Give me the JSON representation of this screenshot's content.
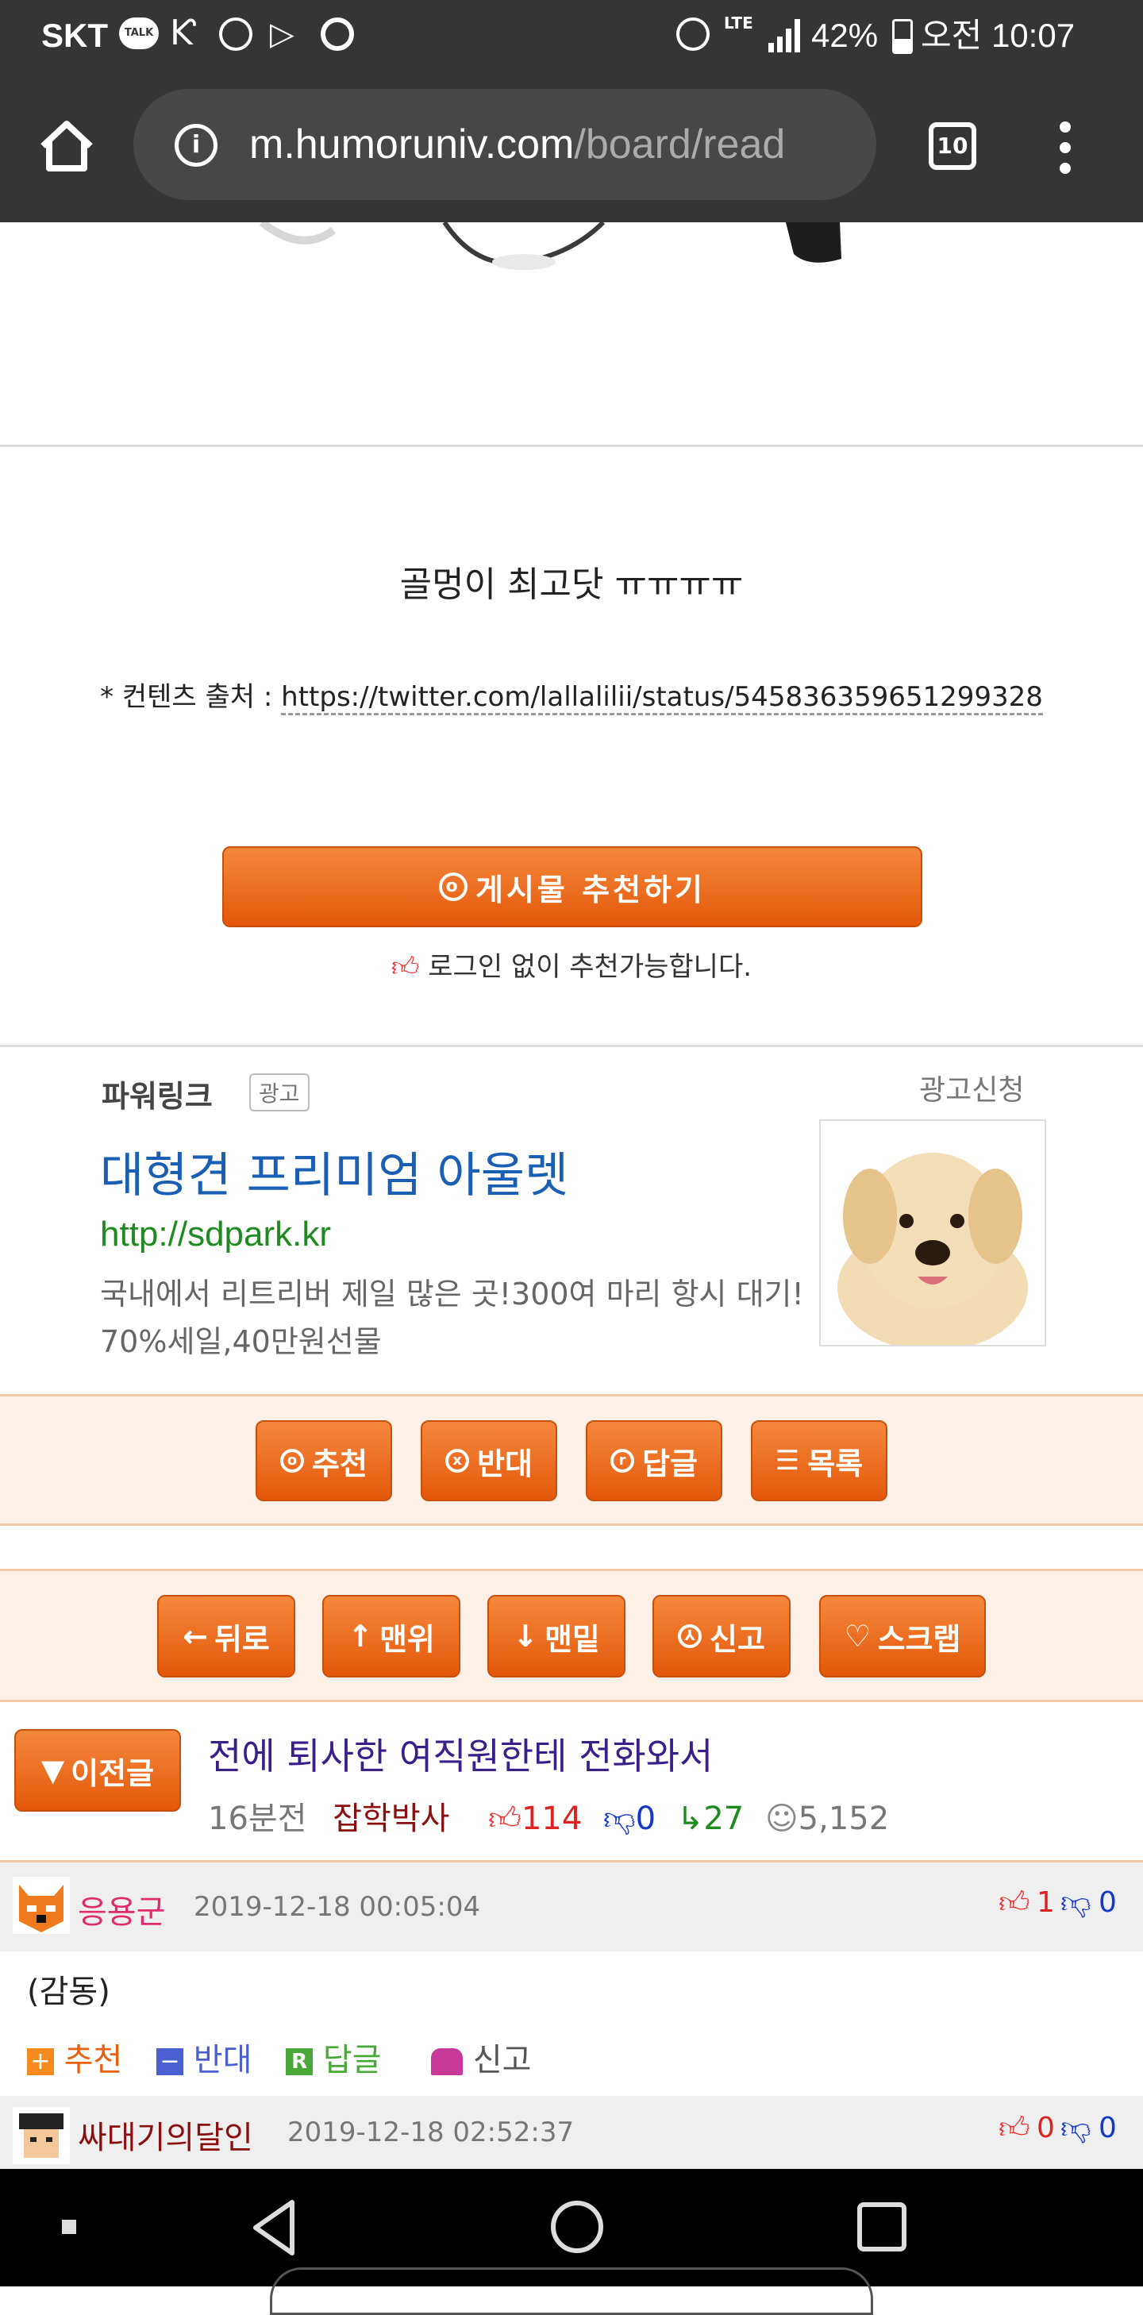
{
  "status": {
    "carrier": "SKT",
    "battery": "42%",
    "time": "오전 10:07",
    "talk_badge": "TALK",
    "lte": "LTE"
  },
  "browser": {
    "url_domain": "m.humoruniv.com",
    "url_path": "/board/read",
    "tab_count": "10"
  },
  "post": {
    "caption": "골멍이 최고닷 ㅠㅠㅠㅠ",
    "source_label": "* 컨텐츠 출처 :",
    "source_url": "https://twitter.com/lallalilii/status/545836359651299328",
    "recommend_button": "게시물   추천하기",
    "login_note": "로그인 없이 추천가능합니다."
  },
  "ad": {
    "brand": "파워링크",
    "badge": "광고",
    "apply": "광고신청",
    "title": "대형견 프리미엄 아울렛",
    "url": "http://sdpark.kr",
    "desc": "국내에서 리트리버 제일 많은 곳!300여 마리 항시 대기! 70%세일,40만원선물"
  },
  "actions": {
    "recommend": "추천",
    "oppose": "반대",
    "reply": "답글",
    "list": "목록"
  },
  "nav_buttons": {
    "back": "뒤로",
    "top": "맨위",
    "bottom": "맨밑",
    "report": "신고",
    "scrap": "스크랩"
  },
  "prev_post": {
    "label": "이전글",
    "title": "전에 퇴사한 여직원한테 전화와서",
    "time": "16분전",
    "author": "잡학박사",
    "likes": "114",
    "dislikes": "0",
    "replies": "27",
    "views": "5,152"
  },
  "comments": [
    {
      "author": "응용군",
      "date": "2019-12-18 00:05:04",
      "up": "1",
      "down": "0",
      "text": "(감동)"
    },
    {
      "author": "싸대기의달인",
      "date": "2019-12-18 02:52:37",
      "up": "0",
      "down": "0"
    }
  ],
  "comment_actions": {
    "recommend": "추천",
    "oppose": "반대",
    "reply": "답글",
    "report": "신고"
  },
  "colors": {
    "accent": "#e8600e",
    "chrome": "#333536",
    "link_blue": "#1a5fb4",
    "ad_green": "#1f8a1f"
  }
}
